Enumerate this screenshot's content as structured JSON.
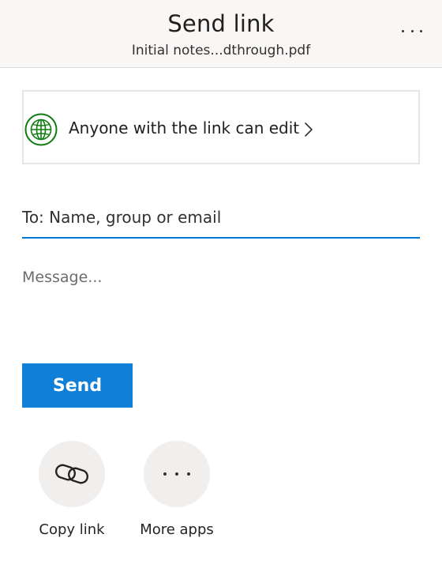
{
  "header": {
    "title": "Send link",
    "filename": "Initial notes...dthrough.pdf",
    "more_icon": "ellipsis-icon"
  },
  "permission": {
    "label": "Anyone with the link can edit",
    "icon": "globe-icon",
    "icon_color": "#107c10",
    "chevron_icon": "chevron-right-icon"
  },
  "to_field": {
    "placeholder": "To: Name, group or email",
    "value": "",
    "accent_color": "#0078d4"
  },
  "message": {
    "placeholder": "Message...",
    "value": ""
  },
  "send_button": {
    "label": "Send",
    "color": "#0f7fd8"
  },
  "share_options": [
    {
      "label": "Copy link",
      "icon": "link-icon"
    },
    {
      "label": "More apps",
      "icon": "ellipsis-icon"
    }
  ]
}
